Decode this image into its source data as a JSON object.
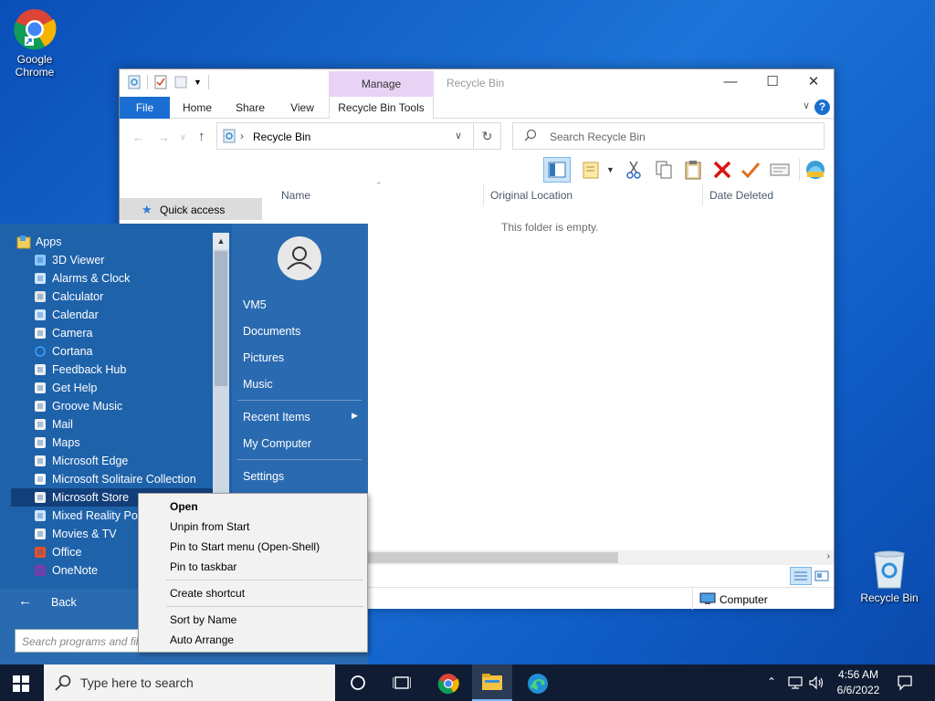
{
  "desktop": {
    "chrome_label": "Google Chrome",
    "recycle_label": "Recycle Bin"
  },
  "explorer": {
    "manage_tab": "Manage",
    "window_title": "Recycle Bin",
    "tabs": {
      "file": "File",
      "home": "Home",
      "share": "Share",
      "view": "View",
      "tools": "Recycle Bin Tools"
    },
    "address": "Recycle Bin",
    "search_placeholder": "Search Recycle Bin",
    "columns": {
      "name": "Name",
      "location": "Original Location",
      "deleted": "Date Deleted"
    },
    "empty_message": "This folder is empty.",
    "quick_access": "Quick access",
    "status_computer": "Computer"
  },
  "start_menu": {
    "apps_header": "Apps",
    "apps": [
      {
        "label": "3D Viewer",
        "icon": "cube-icon"
      },
      {
        "label": "Alarms & Clock",
        "icon": "clock-icon"
      },
      {
        "label": "Calculator",
        "icon": "calculator-icon"
      },
      {
        "label": "Calendar",
        "icon": "calendar-icon"
      },
      {
        "label": "Camera",
        "icon": "camera-icon"
      },
      {
        "label": "Cortana",
        "icon": "cortana-icon"
      },
      {
        "label": "Feedback Hub",
        "icon": "feedback-icon"
      },
      {
        "label": "Get Help",
        "icon": "help-icon"
      },
      {
        "label": "Groove Music",
        "icon": "music-icon"
      },
      {
        "label": "Mail",
        "icon": "mail-icon"
      },
      {
        "label": "Maps",
        "icon": "maps-icon"
      },
      {
        "label": "Microsoft Edge",
        "icon": "edge-icon"
      },
      {
        "label": "Microsoft Solitaire Collection",
        "icon": "cards-icon"
      },
      {
        "label": "Microsoft Store",
        "icon": "store-icon"
      },
      {
        "label": "Mixed Reality Port",
        "icon": "vr-icon"
      },
      {
        "label": "Movies & TV",
        "icon": "film-icon"
      },
      {
        "label": "Office",
        "icon": "office-icon"
      },
      {
        "label": "OneNote",
        "icon": "onenote-icon"
      }
    ],
    "right": {
      "user": "VM5",
      "documents": "Documents",
      "pictures": "Pictures",
      "music": "Music",
      "recent": "Recent Items",
      "computer": "My Computer",
      "settings": "Settings"
    },
    "back": "Back",
    "search_placeholder": "Search programs and file"
  },
  "context_menu": {
    "open": "Open",
    "unpin": "Unpin from Start",
    "pin_start": "Pin to Start menu (Open-Shell)",
    "pin_taskbar": "Pin to taskbar",
    "shortcut": "Create shortcut",
    "sort": "Sort by Name",
    "arrange": "Auto Arrange"
  },
  "taskbar": {
    "search_placeholder": "Type here to search",
    "time": "4:56 AM",
    "date": "6/6/2022"
  }
}
